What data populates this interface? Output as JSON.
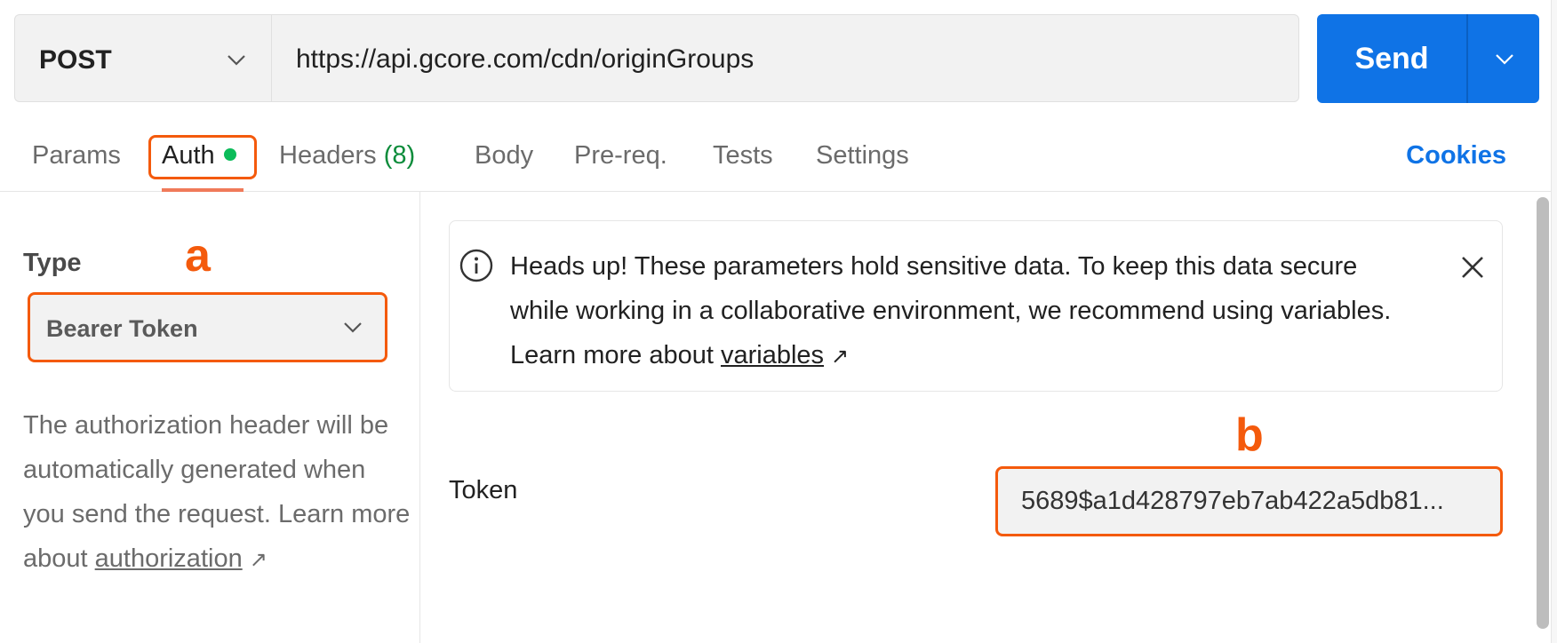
{
  "request": {
    "method": "POST",
    "url": "https://api.gcore.com/cdn/originGroups",
    "send_label": "Send"
  },
  "tabs": [
    {
      "label": "Params"
    },
    {
      "label": "Auth"
    },
    {
      "label": "Headers",
      "count": "(8)"
    },
    {
      "label": "Body"
    },
    {
      "label": "Pre-req."
    },
    {
      "label": "Tests"
    },
    {
      "label": "Settings"
    }
  ],
  "cookies_label": "Cookies",
  "auth": {
    "type_label": "Type",
    "type_value": "Bearer Token",
    "description": "The authorization header will be automatically generated when you send the request. Learn more about ",
    "description_link": "authorization",
    "notice": "Heads up! These parameters hold sensitive data. To keep this data secure while working in a collaborative environment, we recommend using variables. Learn more about ",
    "notice_link": "variables",
    "token_label": "Token",
    "token_value": "5689$a1d428797eb7ab422a5db81..."
  },
  "markers": {
    "a": "a",
    "b": "b"
  },
  "colors": {
    "accent": "#0f73e6",
    "highlight": "#f45a0c",
    "active_dot": "#0cbc5a"
  }
}
